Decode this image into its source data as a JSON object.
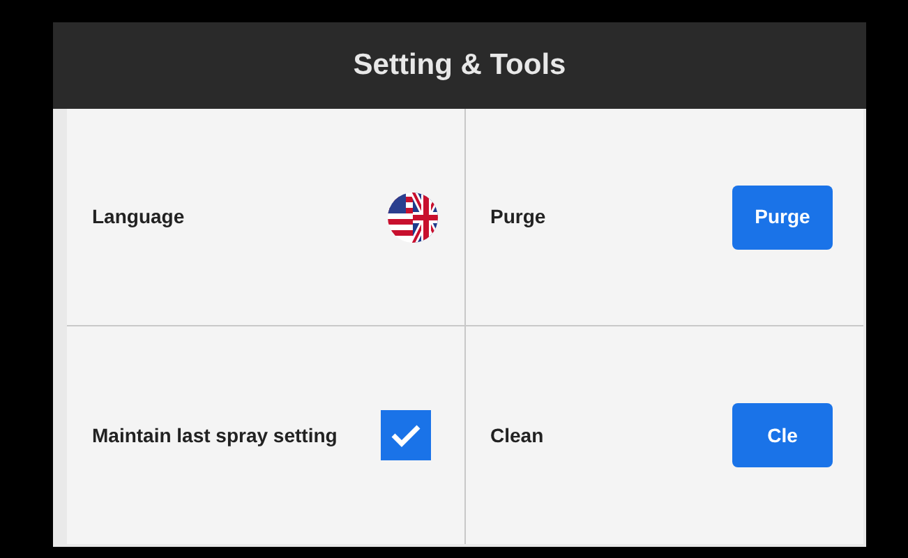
{
  "header": {
    "title": "Setting & Tools"
  },
  "settings": [
    {
      "kind": "language",
      "label": "Language"
    },
    {
      "kind": "button",
      "label": "Purge",
      "button": "Purge"
    },
    {
      "kind": "checkbox",
      "label": "Maintain last spray setting",
      "checked": true
    },
    {
      "kind": "button",
      "label": "Clean",
      "button": "Cle"
    }
  ]
}
